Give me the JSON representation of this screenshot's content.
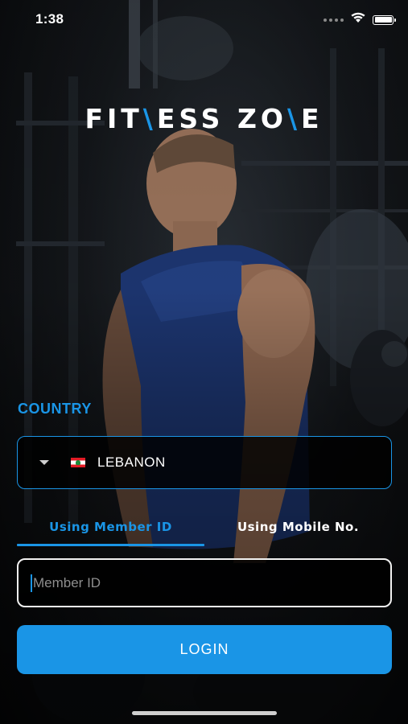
{
  "status_bar": {
    "time": "1:38"
  },
  "logo": {
    "part1": "FIT",
    "part2": "\\",
    "part3": "ESS ZO",
    "part4": "\\",
    "part5": "E"
  },
  "country": {
    "label": "COUNTRY",
    "selected": "LEBANON",
    "flag_icon": "lebanon-flag-icon"
  },
  "tabs": [
    {
      "label": "Using Member ID",
      "active": true
    },
    {
      "label": "Using Mobile No.",
      "active": false
    }
  ],
  "member_input": {
    "placeholder": "Member ID",
    "value": ""
  },
  "login_button": {
    "label": "LOGIN"
  },
  "colors": {
    "accent": "#1a95e6",
    "text": "#ffffff",
    "background": "#000000"
  }
}
